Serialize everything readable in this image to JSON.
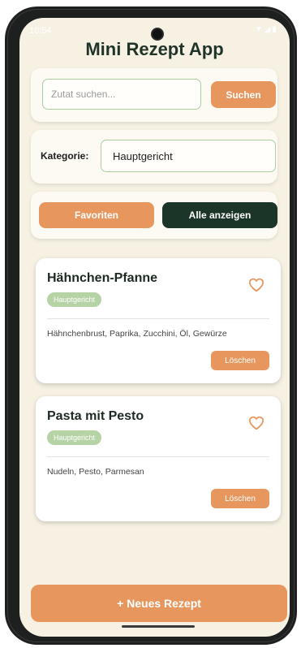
{
  "status": {
    "time": "10:54",
    "icons": "▼◢▮"
  },
  "app": {
    "title": "Mini Rezept App"
  },
  "search": {
    "placeholder": "Zutat suchen...",
    "value": "",
    "button_label": "Suchen"
  },
  "category": {
    "label": "Kategorie:",
    "selected": "Hauptgericht"
  },
  "filters": {
    "favorites_label": "Favoriten",
    "show_all_label": "Alle anzeigen"
  },
  "recipes": [
    {
      "title": "Hähnchen-Pfanne",
      "category": "Hauptgericht",
      "ingredients": "Hähnchenbrust, Paprika, Zucchini, Öl, Gewürze",
      "delete_label": "Löschen",
      "favorite_icon": "heart-outline-icon"
    },
    {
      "title": "Pasta mit Pesto",
      "category": "Hauptgericht",
      "ingredients": "Nudeln, Pesto, Parmesan",
      "delete_label": "Löschen",
      "favorite_icon": "heart-outline-icon"
    }
  ],
  "footer": {
    "new_recipe_label": "+ Neues Rezept"
  },
  "colors": {
    "accent": "#e7975e",
    "dark": "#1c3529",
    "tag": "#b6d3a6",
    "background": "#f6f1e3"
  }
}
